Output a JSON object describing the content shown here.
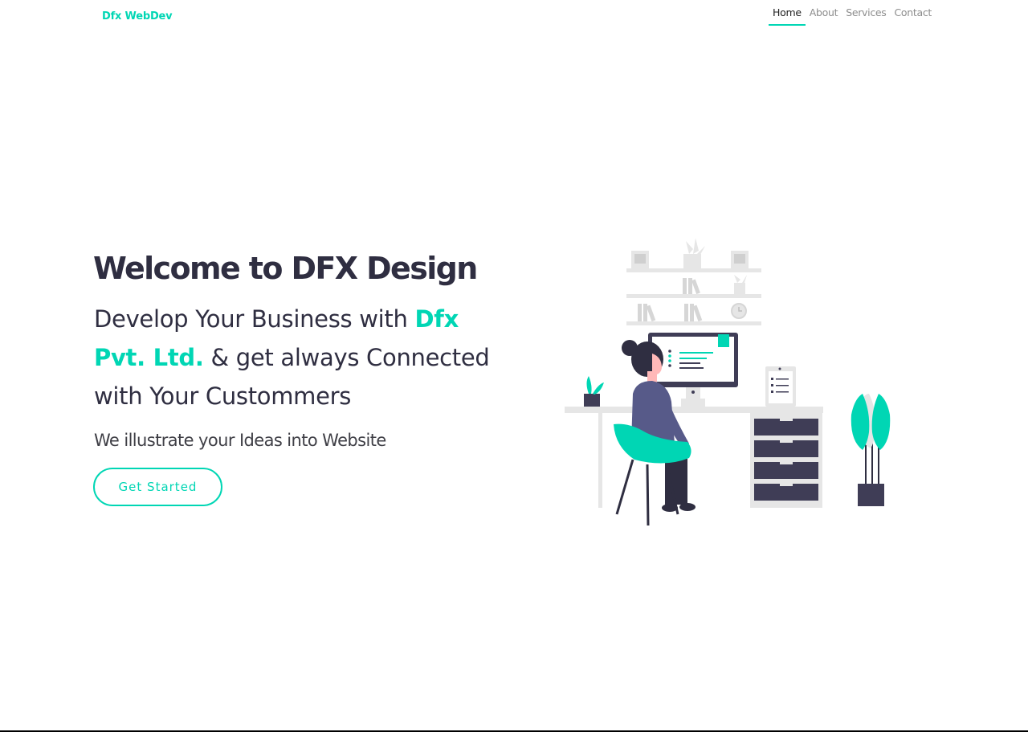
{
  "header": {
    "brand": "Dfx WebDev",
    "nav": [
      {
        "label": "Home",
        "active": true
      },
      {
        "label": "About",
        "active": false
      },
      {
        "label": "Services",
        "active": false
      },
      {
        "label": "Contact",
        "active": false
      }
    ]
  },
  "hero": {
    "title": "Welcome to DFX Design",
    "subtitle_prefix": "Develop Your Business with ",
    "subtitle_accent": "Dfx Pvt. Ltd.",
    "subtitle_suffix": " & get always Connected with Your Custommers",
    "tagline": "We illustrate your Ideas into Website",
    "cta_label": "Get Started"
  },
  "colors": {
    "accent": "#00d6b4",
    "text": "#2f2e41",
    "muted": "#8d8d8d"
  },
  "illustration": {
    "icon": "woman-at-desk-illustration"
  }
}
